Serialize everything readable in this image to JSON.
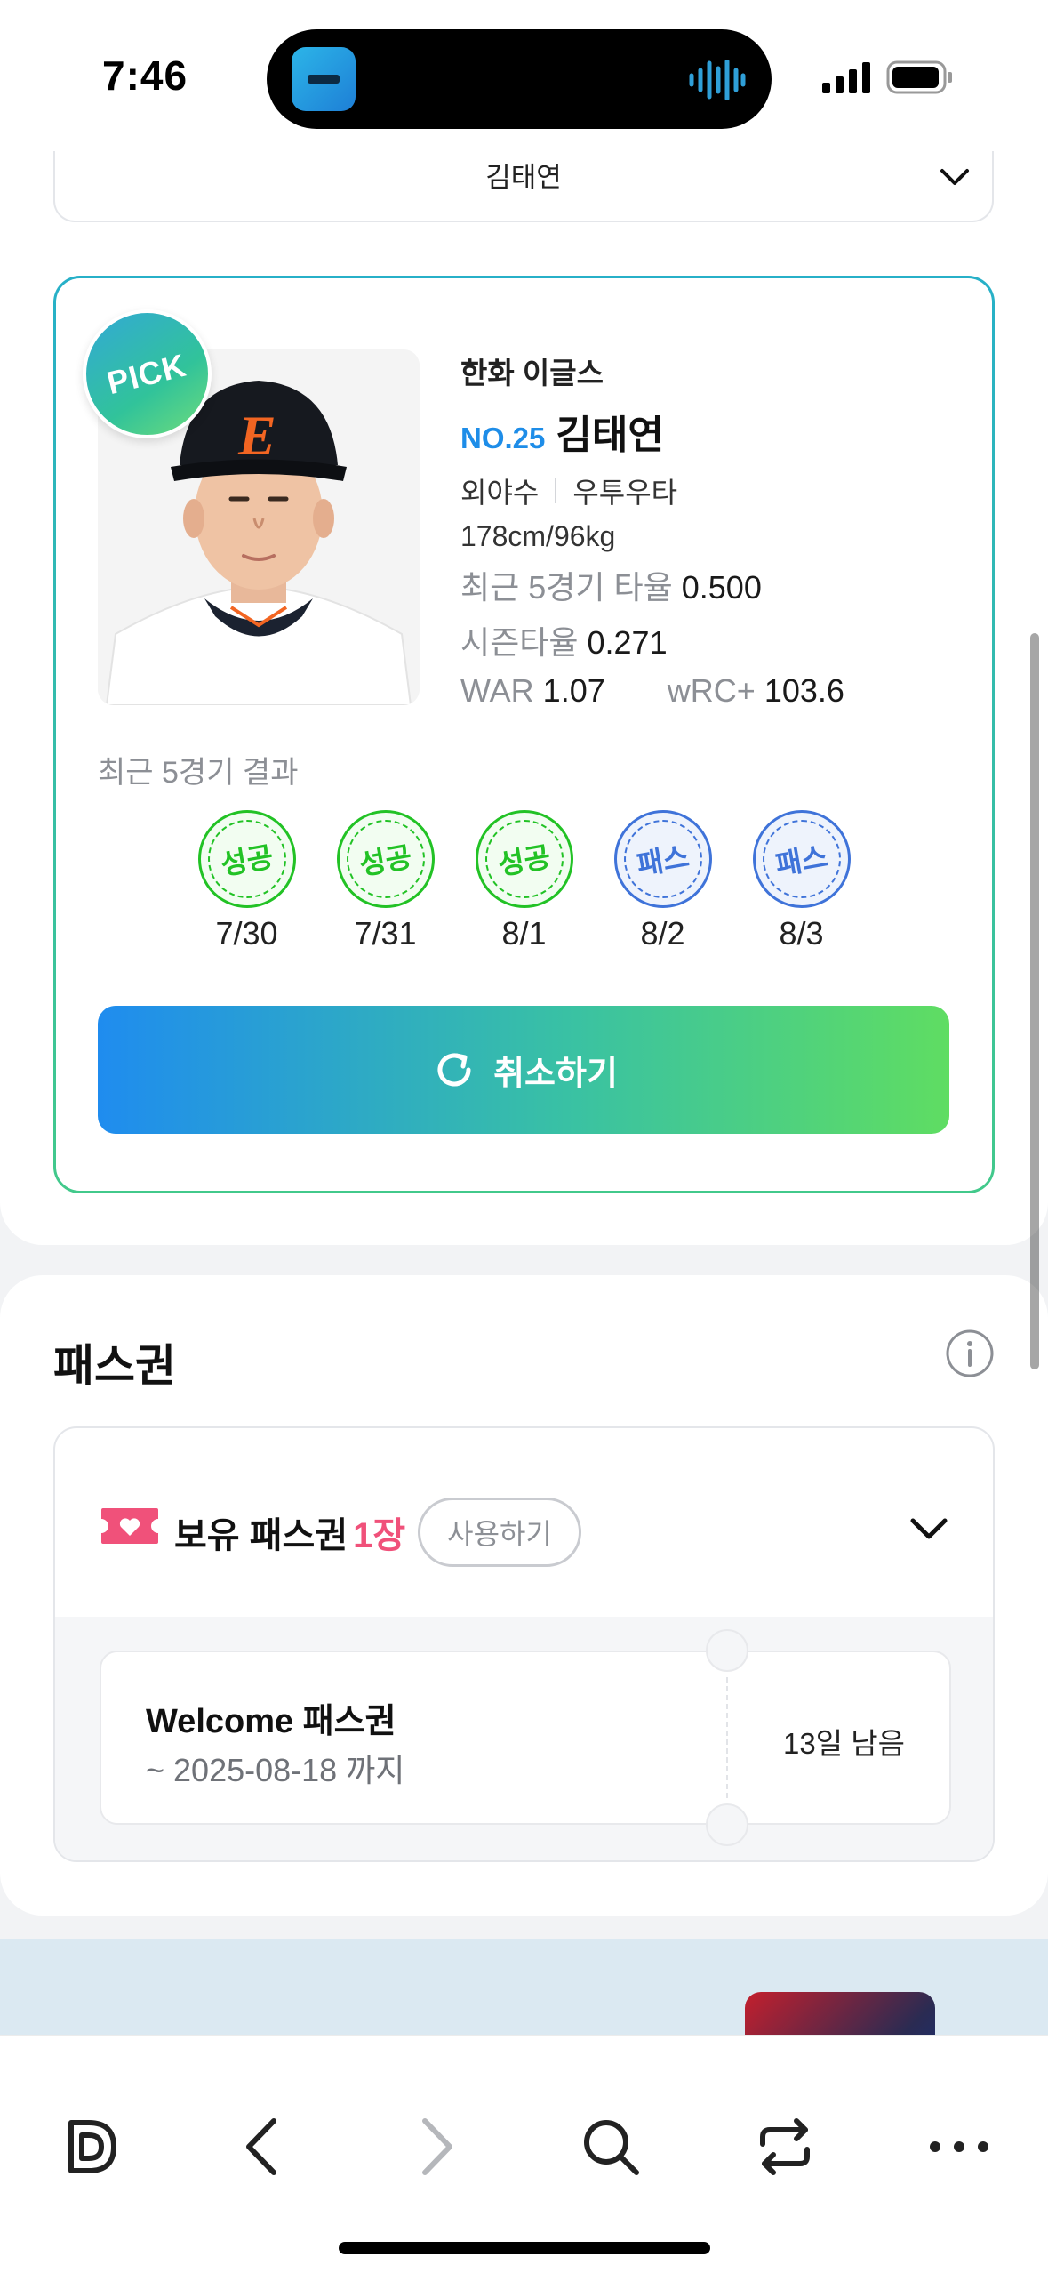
{
  "status_bar": {
    "time": "7:46"
  },
  "player_select": {
    "selected": "김태연"
  },
  "player_card": {
    "badge": "PICK",
    "team": "한화 이글스",
    "number": "NO.25",
    "name": "김태연",
    "position": "외야수",
    "bats_throws": "우투우타",
    "body": "178cm/96kg",
    "stats": {
      "recent5_label": "최근 5경기 타율",
      "recent5_value": "0.500",
      "season_label": "시즌타율",
      "season_value": "0.271",
      "war_label": "WAR",
      "war_value": "1.07",
      "wrc_label": "wRC+",
      "wrc_value": "103.6"
    },
    "recent_results_label": "최근 5경기 결과",
    "results": [
      {
        "label": "성공",
        "date": "7/30",
        "type": "success"
      },
      {
        "label": "성공",
        "date": "7/31",
        "type": "success"
      },
      {
        "label": "성공",
        "date": "8/1",
        "type": "success"
      },
      {
        "label": "패스",
        "date": "8/2",
        "type": "pass"
      },
      {
        "label": "패스",
        "date": "8/3",
        "type": "pass"
      }
    ],
    "cancel_label": "취소하기"
  },
  "pass_section": {
    "title": "패스권",
    "owned_label": "보유 패스권",
    "owned_count": "1장",
    "use_label": "사용하기",
    "coupon": {
      "title": "Welcome 패스권",
      "expiry": "~ 2025-08-18 까지",
      "remaining": "13일 남음"
    }
  },
  "colors": {
    "accent_blue": "#1e8de8",
    "success_green": "#22c225",
    "pass_blue": "#3f73d9",
    "count_pink": "#f0517a"
  }
}
